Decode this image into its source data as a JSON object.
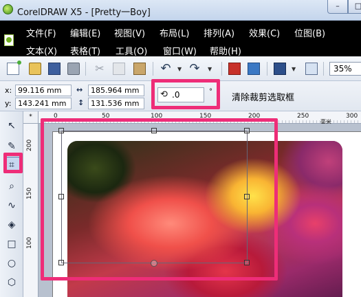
{
  "window": {
    "title": "CorelDRAW X5 - [Pretty一Boy]",
    "minimize_glyph": "–",
    "maximize_glyph": "□"
  },
  "menu": {
    "row1": [
      "文件(F)",
      "编辑(E)",
      "视图(V)",
      "布局(L)",
      "排列(A)",
      "效果(C)",
      "位图(B)"
    ],
    "row2": [
      "文本(X)",
      "表格(T)",
      "工具(O)",
      "窗口(W)",
      "帮助(H)"
    ]
  },
  "toolbar": {
    "icons": [
      "new-document-icon",
      "open-folder-icon",
      "save-icon",
      "print-icon",
      "cut-icon",
      "copy-icon",
      "paste-icon",
      "undo-icon",
      "redo-icon",
      "import-icon",
      "export-icon",
      "application-launcher-icon",
      "welcome-screen-icon"
    ],
    "zoom": "35%"
  },
  "property_bar": {
    "x_label": "x:",
    "x_value": "99.116 mm",
    "y_label": "y:",
    "y_value": "143.241 mm",
    "width_value": "185.964 mm",
    "height_value": "131.536 mm",
    "rotation_value": ".0",
    "rotation_unit": "°",
    "clear_crop_label": "清除裁剪选取框"
  },
  "toolbox": {
    "tools": [
      "pick-tool",
      "shape-tool",
      "crop-tool",
      "zoom-tool",
      "freehand-tool",
      "smart-fill-tool",
      "rectangle-tool",
      "ellipse-tool",
      "polygon-tool"
    ],
    "active": "crop-tool"
  },
  "rulers": {
    "corner_label": "*",
    "horizontal_ticks": [
      "0",
      "50",
      "100",
      "150",
      "200",
      "250",
      "300"
    ],
    "vertical_ticks": [
      "200",
      "150",
      "100"
    ],
    "unit_label": "毫米"
  },
  "colors": {
    "highlight": "#ee2d78",
    "menubar": "#000000",
    "titlebar": "#c4d5ec"
  }
}
